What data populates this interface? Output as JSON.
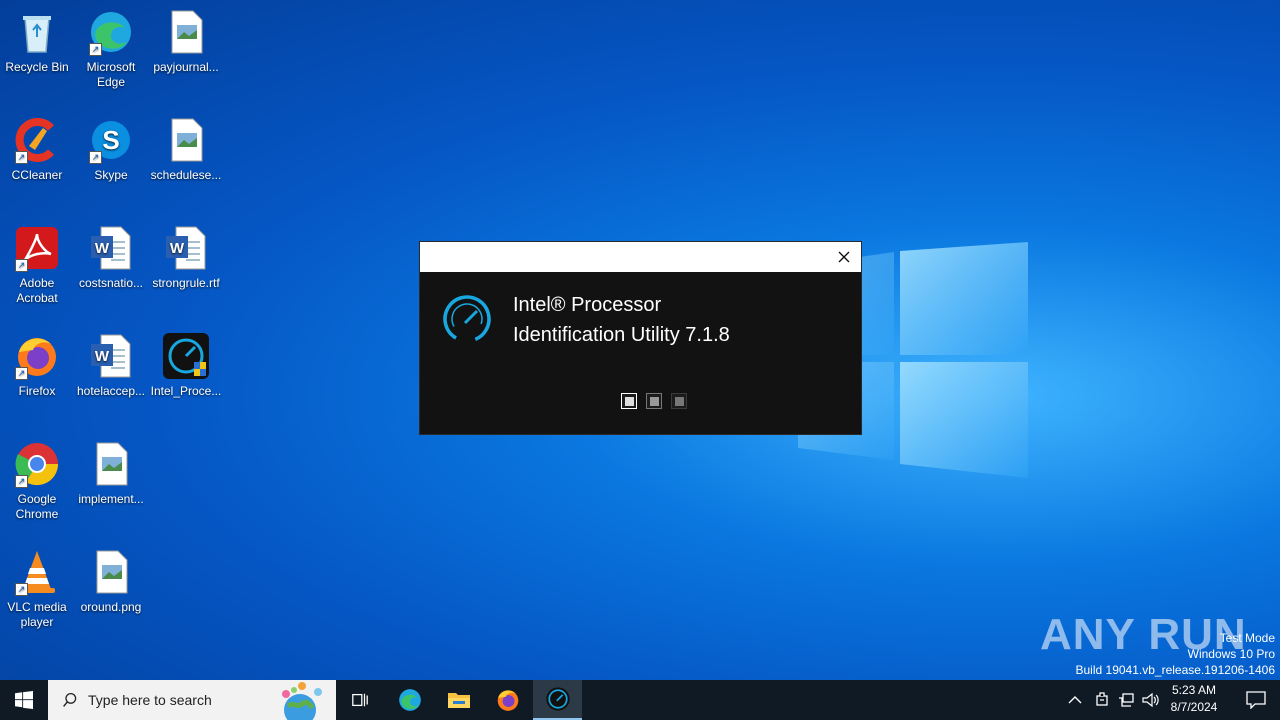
{
  "desktop": {
    "icons": [
      {
        "label": "Recycle Bin",
        "icon": "recycle-bin-icon"
      },
      {
        "label": "Microsoft Edge",
        "icon": "edge-icon"
      },
      {
        "label": "payjournal...",
        "icon": "image-file-icon"
      },
      {
        "label": "CCleaner",
        "icon": "ccleaner-icon"
      },
      {
        "label": "Skype",
        "icon": "skype-icon"
      },
      {
        "label": "schedulese...",
        "icon": "image-file-icon"
      },
      {
        "label": "Adobe Acrobat",
        "icon": "acrobat-icon"
      },
      {
        "label": "costsnatio...",
        "icon": "word-doc-icon"
      },
      {
        "label": "strongrule.rtf",
        "icon": "word-doc-icon"
      },
      {
        "label": "Firefox",
        "icon": "firefox-icon"
      },
      {
        "label": "hotelaccep...",
        "icon": "word-doc-icon"
      },
      {
        "label": "Intel_Proce...",
        "icon": "intel-installer-icon"
      },
      {
        "label": "Google Chrome",
        "icon": "chrome-icon"
      },
      {
        "label": "implement...",
        "icon": "image-file-icon"
      },
      {
        "label": "VLC media player",
        "icon": "vlc-icon"
      },
      {
        "label": "oround.png",
        "icon": "image-file-icon"
      }
    ]
  },
  "splash": {
    "product_line1": "Intel® Processor",
    "product_line2": "Identification Utility 7.1.8",
    "progress_dots": 3,
    "active_dot": 0
  },
  "watermark": {
    "logo_text": "ANY RUN",
    "line1": "Test Mode",
    "line2": "Windows 10 Pro",
    "line3": "Build 19041.vb_release.191206-1406"
  },
  "taskbar": {
    "search_placeholder": "Type here to search",
    "pinned": [
      "task-view-icon",
      "edge-icon",
      "file-explorer-icon",
      "firefox-icon",
      "intel-utility-icon"
    ],
    "clock_time": "5:23 AM",
    "clock_date": "8/7/2024"
  },
  "colors": {
    "desktop_blue": "#0a78e0",
    "taskbar": "#101a24",
    "splash_bg": "#121212",
    "intel_cyan": "#19a7e0"
  }
}
